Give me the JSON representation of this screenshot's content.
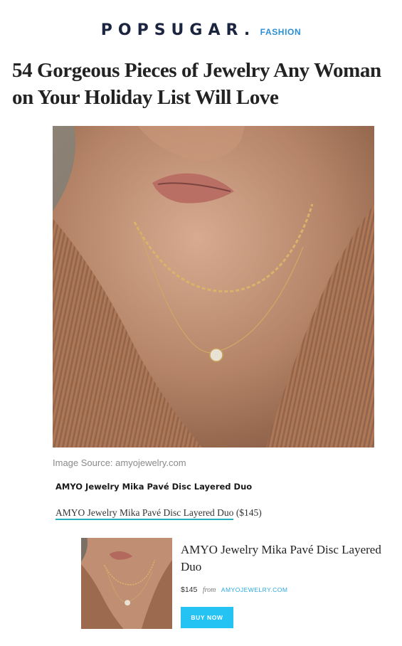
{
  "masthead": {
    "brand": "POPSUGAR.",
    "section": "FASHION"
  },
  "article": {
    "title": "54 Gorgeous Pieces of Jewelry Any Woman on Your Holiday List Will Love"
  },
  "image": {
    "source_credit": "Image Source: amyojewelry.com"
  },
  "product": {
    "heading": "AMYO Jewelry Mika Pavé Disc Layered Duo",
    "link_text": "AMYO Jewelry Mika Pavé Disc Layered Duo",
    "link_price": "($145)",
    "card_title": "AMYO Jewelry Mika Pavé Disc Layered Duo",
    "price": "$145",
    "from_label": "from",
    "store": "AMYOJEWELRY.COM",
    "buy_label": "BUY NOW"
  },
  "colors": {
    "brand": "#1b2540",
    "section": "#2a8fd6",
    "link_underline": "#26aebe",
    "store_link": "#2aa9e0",
    "buy_button": "#25c2f4"
  }
}
